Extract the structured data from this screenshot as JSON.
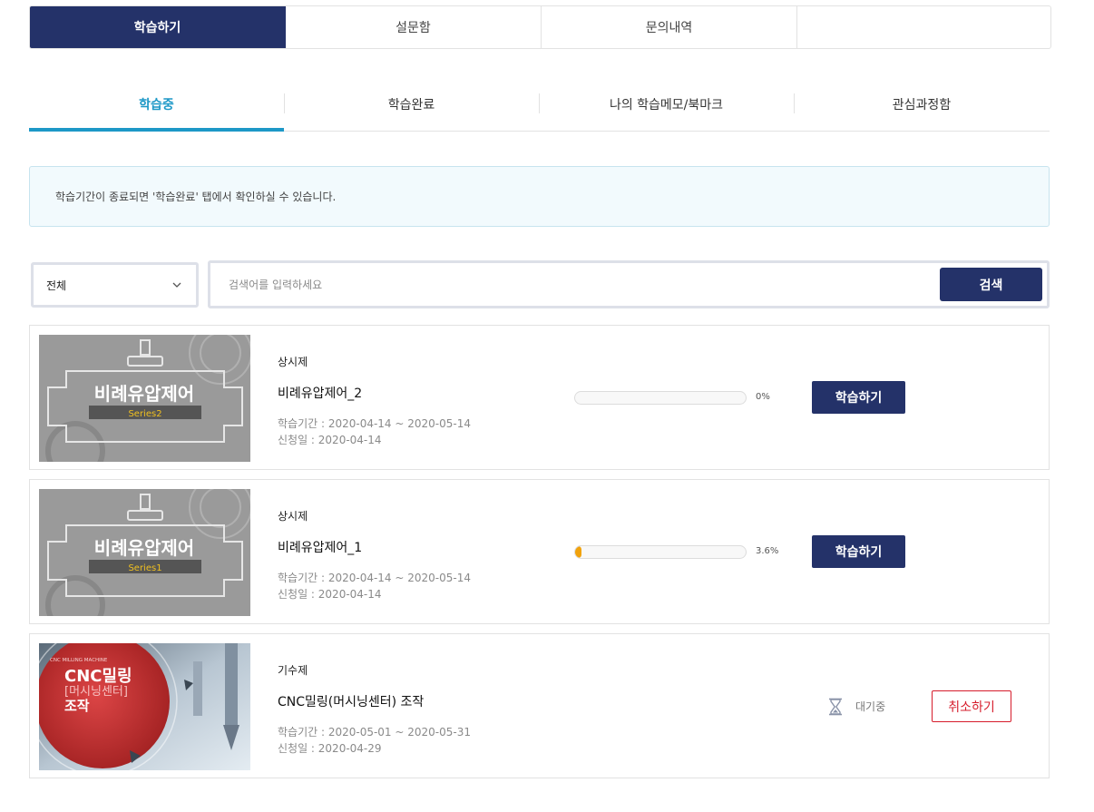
{
  "top_tabs": [
    {
      "label": "학습하기",
      "active": true
    },
    {
      "label": "설문함",
      "active": false
    },
    {
      "label": "문의내역",
      "active": false
    },
    {
      "label": "",
      "active": false
    }
  ],
  "sub_tabs": [
    {
      "label": "학습중",
      "active": true
    },
    {
      "label": "학습완료",
      "active": false
    },
    {
      "label": "나의 학습메모/북마크",
      "active": false
    },
    {
      "label": "관심과정함",
      "active": false
    }
  ],
  "notice": "학습기간이 종료되면 '학습완료' 탭에서 확인하실 수 있습니다.",
  "filter": {
    "selected": "전체",
    "placeholder": "검색어를 입력하세요",
    "search_label": "검색"
  },
  "courses": [
    {
      "thumb_title": "비례유압제어",
      "thumb_series": "Series2",
      "type": "상시제",
      "title": "비례유압제어_2",
      "period": "학습기간 : 2020-04-14 ~ 2020-05-14",
      "applied": "신청일 : 2020-04-14",
      "progress": 0,
      "progress_text": "0%",
      "action_label": "학습하기"
    },
    {
      "thumb_title": "비례유압제어",
      "thumb_series": "Series1",
      "type": "상시제",
      "title": "비례유압제어_1",
      "period": "학습기간 : 2020-04-14 ~ 2020-05-14",
      "applied": "신청일 : 2020-04-14",
      "progress": 3.6,
      "progress_text": "3.6%",
      "action_label": "학습하기"
    },
    {
      "thumb_top": "CNC MILLING MACHINE",
      "thumb_line1": "CNC밀링",
      "thumb_line2": "[머시닝센터]",
      "thumb_line3": "조작",
      "type": "기수제",
      "title": "CNC밀링(머시닝센터) 조작",
      "period": "학습기간 : 2020-05-01 ~ 2020-05-31",
      "applied": "신청일 : 2020-04-29",
      "status": "대기중",
      "action_label": "취소하기"
    }
  ],
  "colors": {
    "primary": "#243269",
    "accent": "#1d98c7",
    "progress": "#f1a20c",
    "cancel": "#d61c2b"
  }
}
